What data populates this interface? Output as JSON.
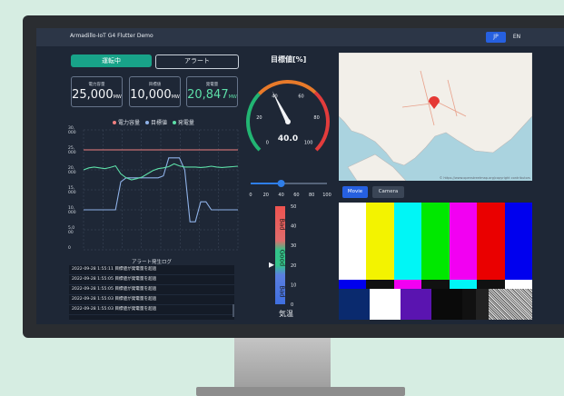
{
  "app": {
    "title": "Armadillo-IoT G4 Flutter Demo",
    "lang_jp": "JP",
    "lang_en": "EN"
  },
  "tabs": {
    "running": "運転中",
    "alert": "アラート"
  },
  "stats": [
    {
      "label": "電力容量",
      "value": "25,000",
      "unit": "MW",
      "color": "#f4f6f8"
    },
    {
      "label": "目標値",
      "value": "10,000",
      "unit": "MW",
      "color": "#f4f6f8"
    },
    {
      "label": "発電量",
      "value": "20,847",
      "unit": "MW",
      "color": "#5ddfa8"
    }
  ],
  "chart_data": {
    "type": "line",
    "legend": [
      "電力容量",
      "目標値",
      "発電量"
    ],
    "y_ticks": [
      "0",
      "5,0\n00",
      "10,\n000",
      "15,\n000",
      "20,\n000",
      "25,\n000",
      "30,\n000"
    ],
    "ylim": [
      0,
      30000
    ],
    "series": [
      {
        "name": "電力容量",
        "color": "#f08080",
        "values": [
          25000,
          25000,
          25000,
          25000,
          25000,
          25000,
          25000,
          25000,
          25000,
          25000,
          25000,
          25000,
          25000,
          25000,
          25000,
          25000,
          25000,
          25000,
          25000,
          25000,
          25000,
          25000,
          25000,
          25000,
          25000,
          25000,
          25000,
          25000,
          25000,
          25000
        ]
      },
      {
        "name": "目標値",
        "color": "#8fb2e8",
        "values": [
          10000,
          10000,
          10000,
          10000,
          10000,
          10000,
          10000,
          17000,
          18000,
          18000,
          18000,
          18000,
          18000,
          18000,
          18000,
          18500,
          23000,
          23000,
          23000,
          20000,
          7000,
          7000,
          12000,
          12000,
          10000,
          10000,
          10000,
          10000,
          10000,
          10000
        ]
      },
      {
        "name": "発電量",
        "color": "#5ddfa8",
        "values": [
          20000,
          20500,
          20700,
          20500,
          20300,
          20600,
          21000,
          19000,
          18000,
          17500,
          17800,
          18200,
          19000,
          19800,
          20300,
          20500,
          20800,
          21500,
          21000,
          20700,
          20700,
          20700,
          20600,
          20700,
          20900,
          20700,
          20600,
          20700,
          20800,
          20900
        ]
      }
    ]
  },
  "alert_log": {
    "title": "アラート発生ログ",
    "rows": [
      "2022-09-28 1:55:11 目標値が発電量を超過",
      "2022-09-28 1:55:05 目標値が発電量を超過",
      "2022-09-28 1:55:05 目標値が発電量を超過",
      "2022-09-28 1:55:03 目標値が発電量を超過",
      "2022-09-28 1:55:03 目標値が発電量を超過"
    ]
  },
  "gauge": {
    "title": "目標値[%]",
    "value": 40.0,
    "value_text": "40.0",
    "ticks": [
      "0",
      "20",
      "40",
      "60",
      "80",
      "100"
    ]
  },
  "slider": {
    "value": 40,
    "ticks": [
      "0",
      "20",
      "40",
      "60",
      "80",
      "100"
    ]
  },
  "temperature": {
    "label": "気温",
    "ticks": [
      "0",
      "10",
      "20",
      "30",
      "40",
      "50"
    ],
    "value": 20,
    "zones": [
      "Bad",
      "Good",
      "Bad"
    ]
  },
  "map": {
    "credit": "© https://www.openstreetmap.org/copyright contributors"
  },
  "video": {
    "movie_tab": "Movie",
    "camera_tab": "Camera"
  }
}
